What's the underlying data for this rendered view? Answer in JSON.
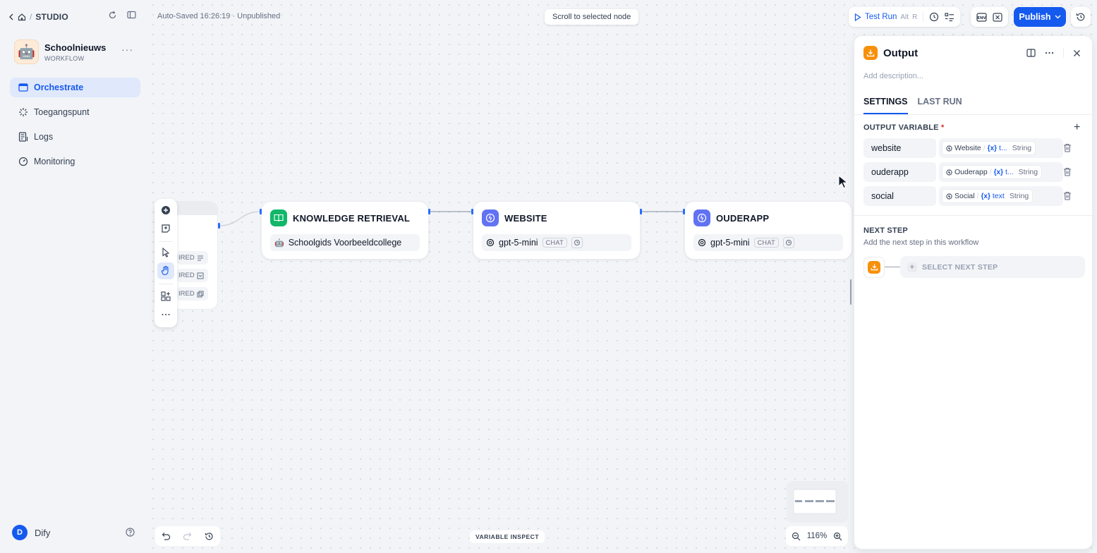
{
  "breadcrumb": {
    "studio": "STUDIO"
  },
  "app": {
    "name": "Schoolnieuws",
    "type": "WORKFLOW",
    "more": "···"
  },
  "nav": [
    {
      "label": "Orchestrate",
      "active": true
    },
    {
      "label": "Toegangspunt"
    },
    {
      "label": "Logs"
    },
    {
      "label": "Monitoring"
    }
  ],
  "user": {
    "initial": "D",
    "name": "Dify"
  },
  "header": {
    "autosave": "Auto-Saved 16:26:19 · Unpublished",
    "scroll_to_selected": "Scroll to selected node",
    "test_run": "Test Run",
    "shortcut_alt": "Alt",
    "shortcut_key": "R",
    "publish": "Publish"
  },
  "start_node": {
    "req_label": "IRED"
  },
  "nodes": [
    {
      "title": "KNOWLEDGE RETRIEVAL",
      "body": "Schoolgids Voorbeeldcollege",
      "icon_color": "#12b76a"
    },
    {
      "title": "WEBSITE",
      "model": "gpt-5-mini",
      "tag": "CHAT",
      "icon_color": "#6172f3"
    },
    {
      "title": "OUDERAPP",
      "model": "gpt-5-mini",
      "tag": "CHAT",
      "icon_color": "#6172f3"
    }
  ],
  "canvas": {
    "variable_inspect": "VARIABLE INSPECT",
    "zoom": "116%"
  },
  "panel": {
    "title": "Output",
    "description_placeholder": "Add description...",
    "tabs": [
      "SETTINGS",
      "LAST RUN"
    ],
    "output_variable_title": "OUTPUT VARIABLE",
    "required_mark": "*",
    "variables": [
      {
        "name": "website",
        "node": "Website",
        "var": "t...",
        "type": "String"
      },
      {
        "name": "ouderapp",
        "node": "Ouderapp",
        "var": "t...",
        "type": "String"
      },
      {
        "name": "social",
        "node": "Social",
        "var": "text",
        "type": "String"
      }
    ],
    "next_step_title": "NEXT STEP",
    "next_step_sub": "Add the next step in this workflow",
    "select_next_step": "SELECT NEXT STEP"
  },
  "colors": {
    "accent": "#155aef",
    "output_icon": "#f79009"
  }
}
